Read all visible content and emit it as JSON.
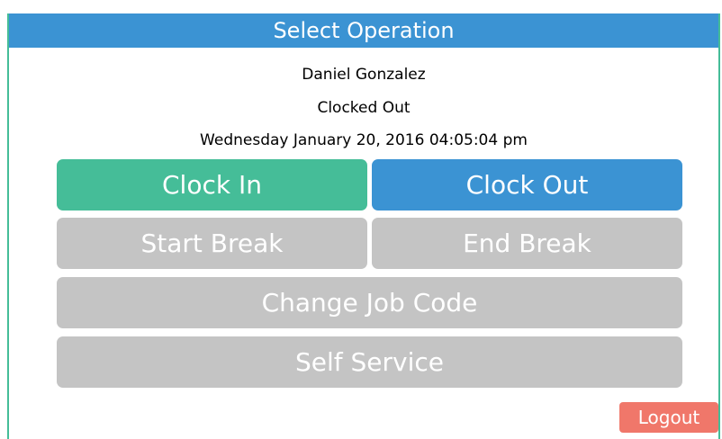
{
  "header": {
    "title": "Select Operation"
  },
  "user": {
    "name": "Daniel Gonzalez",
    "status": "Clocked Out",
    "datetime": "Wednesday January 20, 2016 04:05:04 pm"
  },
  "buttons": {
    "clock_in": "Clock In",
    "clock_out": "Clock Out",
    "start_break": "Start Break",
    "end_break": "End Break",
    "change_job_code": "Change Job Code",
    "self_service": "Self Service",
    "logout": "Logout"
  },
  "colors": {
    "header": "#3b93d3",
    "clock_in": "#45bd98",
    "clock_out": "#3b93d3",
    "disabled": "#c4c4c4",
    "logout": "#f0776a"
  }
}
